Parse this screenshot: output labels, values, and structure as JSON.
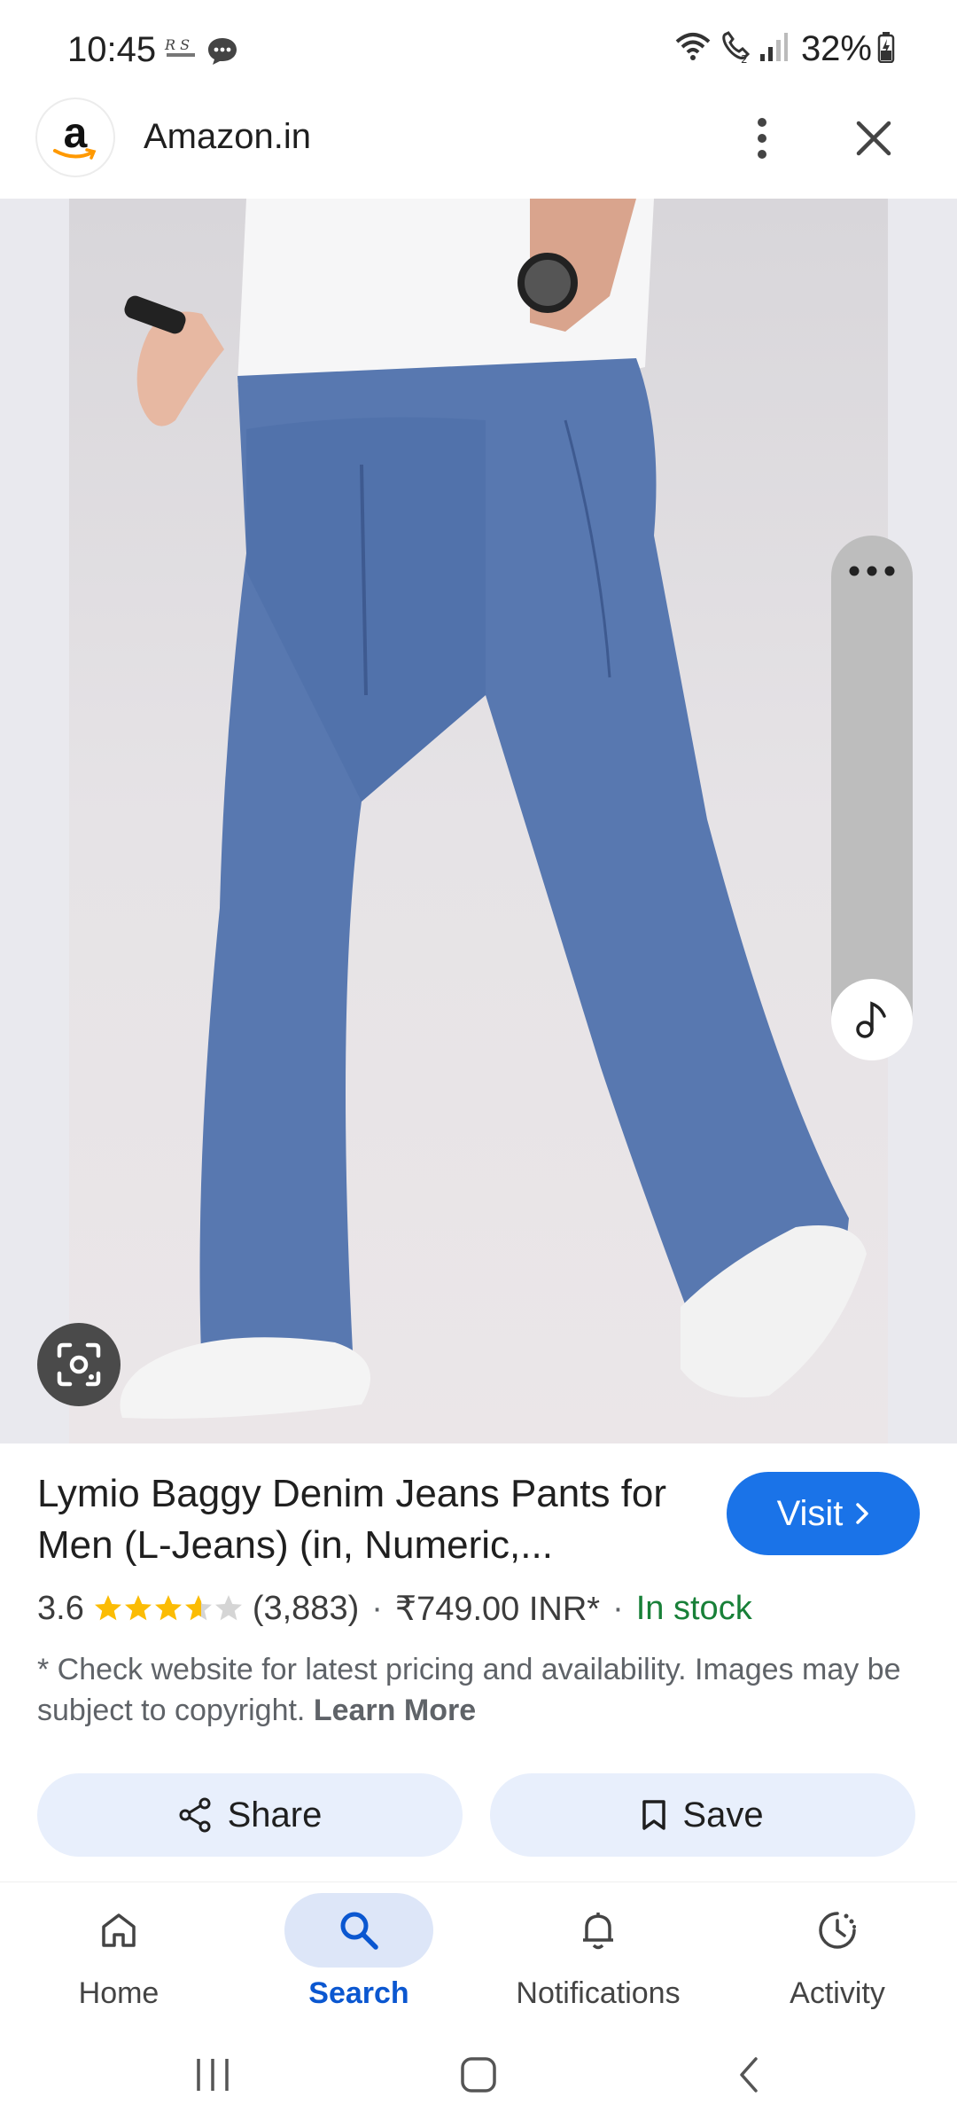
{
  "status_bar": {
    "time": "10:45",
    "battery": "32%",
    "icons": [
      "notification-badge-icon",
      "message-icon",
      "wifi-icon",
      "volte-call-icon",
      "signal-icon",
      "battery-icon"
    ]
  },
  "top_bar": {
    "site_logo_letter": "a",
    "site_name": "Amazon.in",
    "icons": [
      "more-vert-icon",
      "close-icon"
    ]
  },
  "image_viewer": {
    "icons": [
      "google-lens-icon",
      "more-horiz-icon",
      "music-note-icon"
    ]
  },
  "product": {
    "title": "Lymio Baggy Denim Jeans Pants for Men (L-Jeans) (in, Numeric,...",
    "visit_label": "Visit",
    "rating": "3.6",
    "rating_value": 3.6,
    "rating_max": 5,
    "review_count": "(3,883)",
    "separator": "·",
    "price": "₹749.00 INR*",
    "stock": "In stock",
    "disclaimer": "* Check website for latest pricing and availability. Images may be subject to copyright.",
    "learn_more": "Learn More"
  },
  "actions": {
    "share_label": "Share",
    "save_label": "Save"
  },
  "bottom_nav": {
    "items": [
      {
        "label": "Home",
        "icon": "home-icon",
        "active": false
      },
      {
        "label": "Search",
        "icon": "search-icon",
        "active": true
      },
      {
        "label": "Notifications",
        "icon": "bell-icon",
        "active": false
      },
      {
        "label": "Activity",
        "icon": "activity-icon",
        "active": false
      }
    ]
  },
  "colors": {
    "accent": "#1a73e8",
    "stock_green": "#188038",
    "star": "#fbbc04",
    "action_bg": "#e8effc",
    "nav_active_bg": "#dde6f8"
  }
}
